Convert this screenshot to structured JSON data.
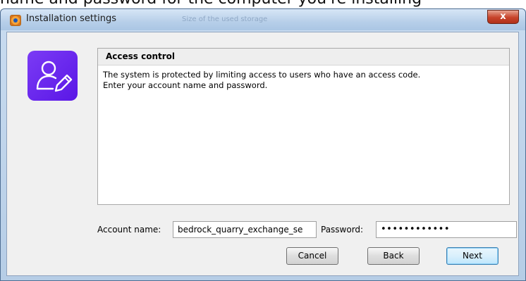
{
  "background_text": "name and password for the computer you're installing",
  "window": {
    "title": "Installation settings",
    "ghost_text": "Size of the used storage",
    "close_glyph": "x",
    "icon": "installer-icon"
  },
  "panel": {
    "title": "Access control",
    "lines": [
      "The system is protected by limiting access to users who have an access code.",
      "Enter your account name and password."
    ],
    "icon": "user-edit-icon",
    "icon_color": "#6a28f0"
  },
  "form": {
    "account_label": "Account name:",
    "account_value": "bedrock_quarry_exchange_se",
    "password_label": "Password:",
    "password_value": "••••••••••••"
  },
  "buttons": {
    "cancel": "Cancel",
    "back": "Back",
    "next": "Next"
  }
}
